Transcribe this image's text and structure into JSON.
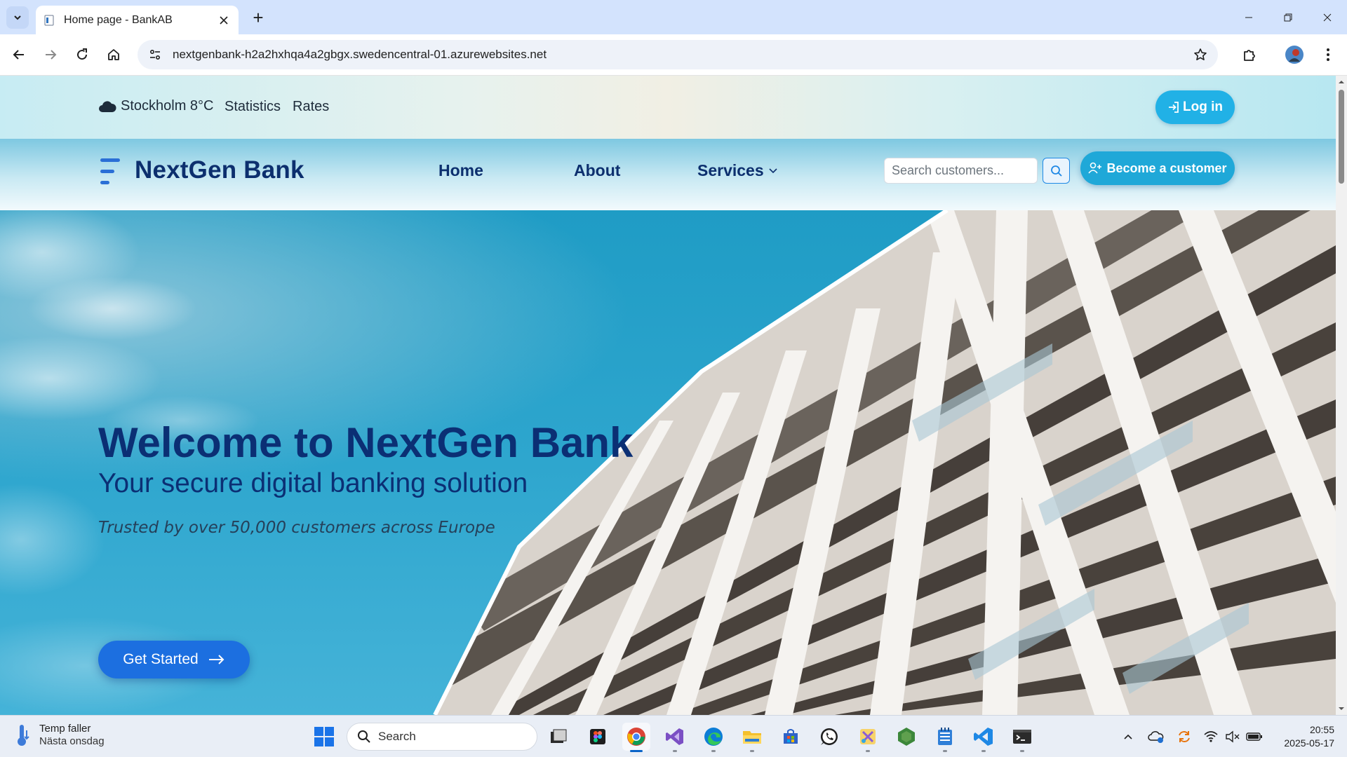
{
  "browser": {
    "tab_title": "Home page - BankAB",
    "url": "nextgenbank-h2a2hxhqa4a2gbgx.swedencentral-01.azurewebsites.net",
    "new_tab_label": "+"
  },
  "topbar": {
    "weather": "Stockholm 8°C",
    "links": [
      "Statistics",
      "Rates"
    ],
    "login_label": "Log in"
  },
  "navbar": {
    "brand": "NextGen Bank",
    "links": [
      "Home",
      "About",
      "Services"
    ],
    "search_placeholder": "Search customers...",
    "become_label": "Become a customer"
  },
  "hero": {
    "title": "Welcome to NextGen Bank",
    "subtitle": "Your secure digital banking solution",
    "trust": "Trusted by over 50,000 customers across Europe",
    "cta_label": "Get Started"
  },
  "taskbar": {
    "widget_title": "Temp faller",
    "widget_sub": "Nästa onsdag",
    "search_label": "Search",
    "time": "20:55",
    "date": "2025-05-17",
    "apps": [
      "task-view",
      "figma",
      "chrome",
      "visual-studio",
      "edge",
      "file-explorer",
      "microsoft-store",
      "whatsapp",
      "snipping-tool",
      "nodejs",
      "notepad",
      "vscode",
      "terminal"
    ]
  },
  "colors": {
    "brand_navy": "#0c2f6e",
    "accent_cyan": "#21b1e6",
    "cta_blue": "#1c6fe0",
    "sky": "#2aa6cc"
  }
}
